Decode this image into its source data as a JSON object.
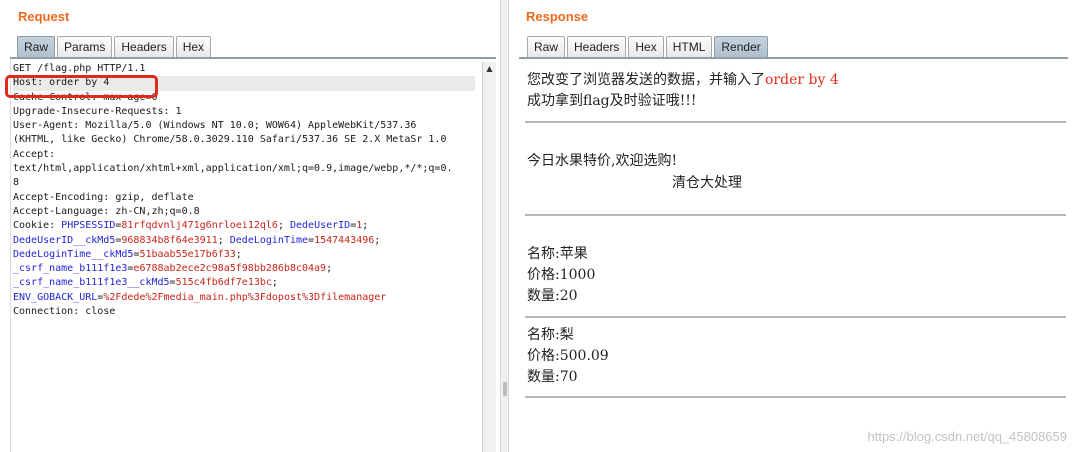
{
  "request": {
    "title": "Request",
    "tabs": [
      "Raw",
      "Params",
      "Headers",
      "Hex"
    ],
    "active_tab": "Raw",
    "lines": [
      "GET /flag.php HTTP/1.1",
      "Host: order by 4",
      "Cache-Control: max-age=0",
      "Upgrade-Insecure-Requests: 1",
      "User-Agent: Mozilla/5.0 (Windows NT 10.0; WOW64) AppleWebKit/537.36",
      "(KHTML, like Gecko) Chrome/58.0.3029.110 Safari/537.36 SE 2.X MetaSr 1.0",
      "Accept:",
      "text/html,application/xhtml+xml,application/xml;q=0.9,image/webp,*/*;q=0.",
      "8",
      "Accept-Encoding: gzip, deflate",
      "Accept-Language: zh-CN,zh;q=0.8"
    ],
    "cookie": {
      "label": "Cookie: ",
      "line1": [
        {
          "name": "PHPSESSID",
          "value": "81rfqdvnlj471g6nrloei12ql6"
        },
        {
          "name": "DedeUserID",
          "value": "1"
        }
      ],
      "line2": [
        {
          "name": "DedeUserID__ckMd5",
          "value": "968834b8f64e3911"
        },
        {
          "name": "DedeLoginTime",
          "value": "1547443496"
        }
      ],
      "line3": [
        {
          "name": "DedeLoginTime__ckMd5",
          "value": "51baab55e17b6f33"
        }
      ],
      "line4": [
        {
          "name": "_csrf_name_b111f1e3",
          "value": "e6788ab2ece2c98a5f98bb286b8c04a9"
        }
      ],
      "line5": [
        {
          "name": "_csrf_name_b111f1e3__ckMd5",
          "value": "515c4fb6df7e13bc"
        }
      ],
      "line6": [
        {
          "name": "ENV_GOBACK_URL",
          "value": "%2Fdede%2Fmedia_main.php%3Fdopost%3Dfilemanager"
        }
      ]
    },
    "connection_line": "Connection: close"
  },
  "response": {
    "title": "Response",
    "tabs": [
      "Raw",
      "Headers",
      "Hex",
      "HTML",
      "Render"
    ],
    "active_tab": "Render",
    "msg1_prefix": "您改变了浏览器发送的数据，并输入了",
    "msg1_highlight": "order by 4",
    "msg2": "成功拿到flag及时验证哦!!!",
    "promo_line": "今日水果特价,欢迎选购!",
    "marquee": "清仓大处理",
    "items": [
      {
        "name": "名称:苹果",
        "price": "价格:1000",
        "qty": "数量:20"
      },
      {
        "name": "名称:梨",
        "price": "价格:500.09",
        "qty": "数量:70"
      }
    ]
  },
  "watermark": "https://blog.csdn.net/qq_45808659",
  "colors": {
    "title_orange": "#f06a1e",
    "highlight_red": "#e12a1a",
    "cookie_name_blue": "#2424d6",
    "cookie_value_red": "#c8251a",
    "annotation_box_red": "#e0291c",
    "active_tab": "#b9c8d5"
  },
  "icons": {
    "scroll_up": "scroll-up-arrow-icon"
  }
}
